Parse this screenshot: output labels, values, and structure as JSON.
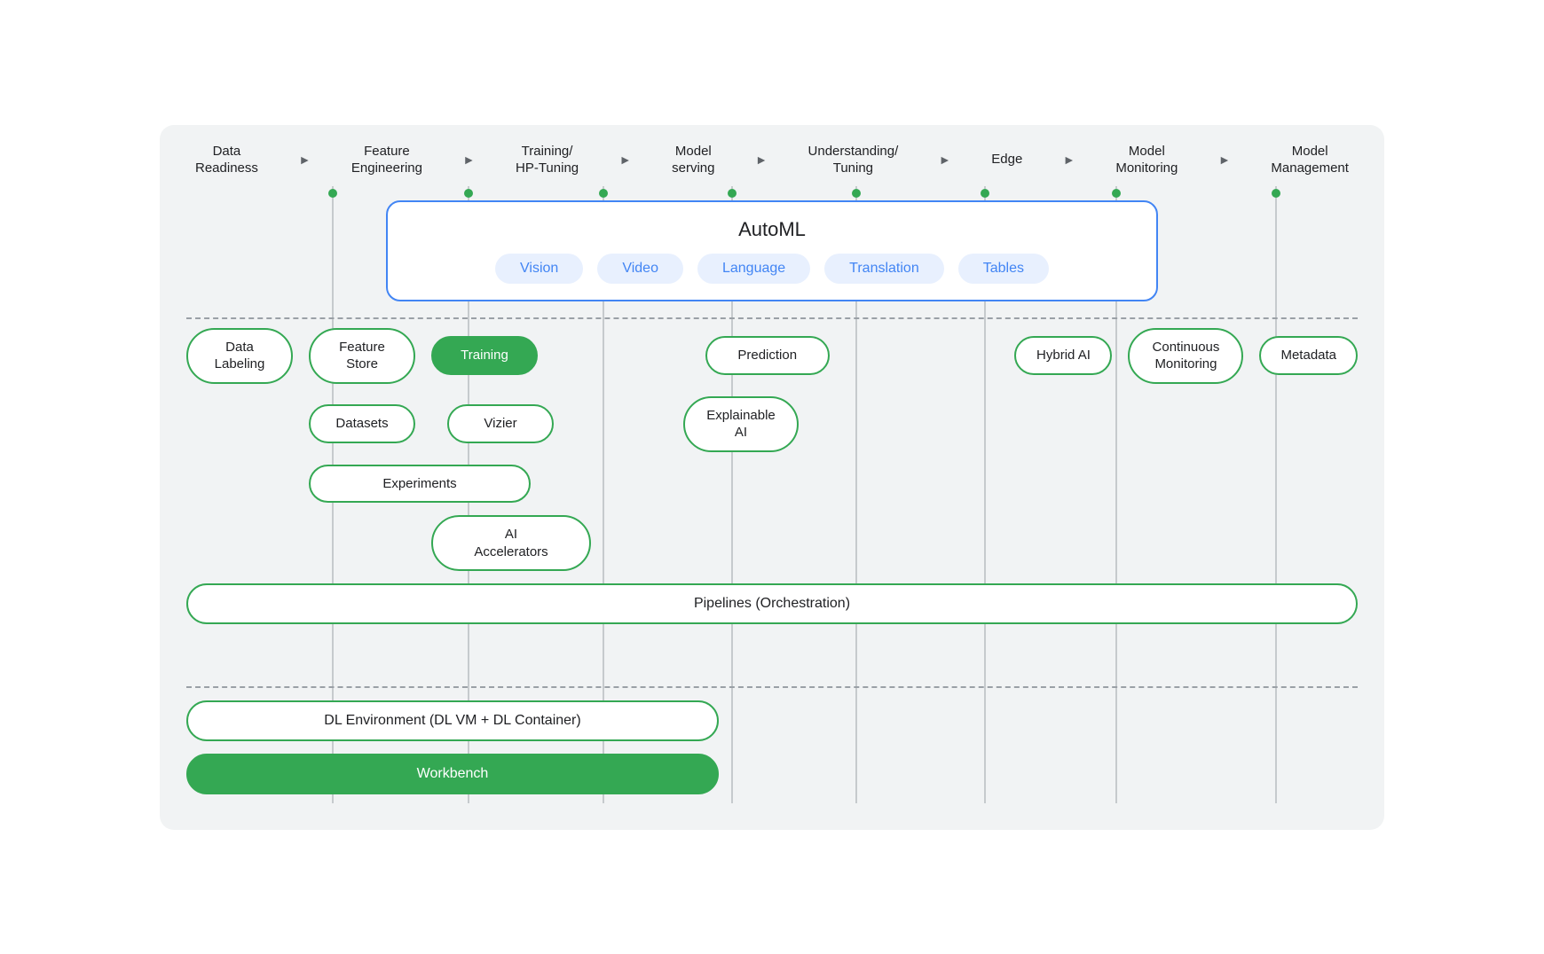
{
  "pipeline": {
    "steps": [
      {
        "label": "Data\nReadiness"
      },
      {
        "label": "Feature\nEngineering"
      },
      {
        "label": "Training/\nHP-Tuning"
      },
      {
        "label": "Model\nserving"
      },
      {
        "label": "Understanding/\nTuning"
      },
      {
        "label": "Edge"
      },
      {
        "label": "Model\nMonitoring"
      },
      {
        "label": "Model\nManagement"
      }
    ]
  },
  "automl": {
    "title": "AutoML",
    "pills": [
      "Vision",
      "Video",
      "Language",
      "Translation",
      "Tables"
    ]
  },
  "pills": {
    "row1": [
      {
        "label": "Data\nLabeling",
        "filled": false
      },
      {
        "label": "Feature\nStore",
        "filled": false
      },
      {
        "label": "Training",
        "filled": true
      },
      {
        "label": "Prediction",
        "filled": false
      },
      {
        "label": "Hybrid AI",
        "filled": false
      },
      {
        "label": "Continuous\nMonitoring",
        "filled": false
      },
      {
        "label": "Metadata",
        "filled": false
      }
    ],
    "row2": [
      {
        "label": "Datasets",
        "filled": false
      },
      {
        "label": "Vizier",
        "filled": false
      },
      {
        "label": "Explainable\nAI",
        "filled": false
      }
    ],
    "row3": [
      {
        "label": "Experiments",
        "filled": false
      }
    ],
    "row4": [
      {
        "label": "AI\nAccelerators",
        "filled": false
      }
    ],
    "pipelines": "Pipelines (Orchestration)",
    "dl_env": "DL Environment (DL VM + DL Container)",
    "workbench": "Workbench"
  }
}
